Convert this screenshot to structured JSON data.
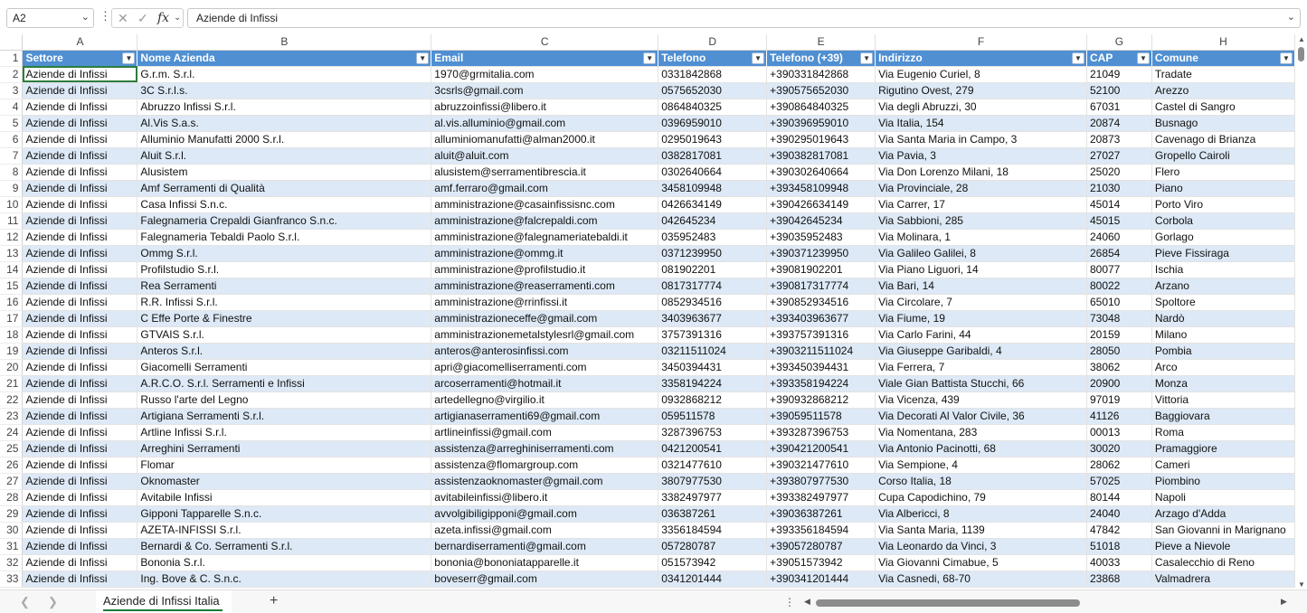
{
  "formula_bar": {
    "name_box": "A2",
    "cancel_icon": "✕",
    "enter_icon": "✓",
    "fx_label": "fx",
    "formula": "Aziende di Infissi"
  },
  "columns": [
    "A",
    "B",
    "C",
    "D",
    "E",
    "F",
    "G",
    "H"
  ],
  "headers": [
    "Settore",
    "Nome Azienda",
    "Email",
    "Telefono",
    "Telefono (+39)",
    "Indirizzo",
    "CAP",
    "Comune"
  ],
  "rows": [
    {
      "n": "2",
      "cells": [
        "Aziende di Infissi",
        "G.r.m. S.r.l.",
        "1970@grmitalia.com",
        "0331842868",
        "+390331842868",
        "Via Eugenio Curiel, 8",
        "21049",
        "Tradate"
      ]
    },
    {
      "n": "3",
      "cells": [
        "Aziende di Infissi",
        "3C S.r.l.s.",
        "3csrls@gmail.com",
        "0575652030",
        "+390575652030",
        "Rigutino Ovest, 279",
        "52100",
        "Arezzo"
      ]
    },
    {
      "n": "4",
      "cells": [
        "Aziende di Infissi",
        "Abruzzo Infissi S.r.l.",
        "abruzzoinfissi@libero.it",
        "0864840325",
        "+390864840325",
        "Via degli Abruzzi, 30",
        "67031",
        "Castel di Sangro"
      ]
    },
    {
      "n": "5",
      "cells": [
        "Aziende di Infissi",
        "Al.Vis S.a.s.",
        "al.vis.alluminio@gmail.com",
        "0396959010",
        "+390396959010",
        "Via Italia, 154",
        "20874",
        "Busnago"
      ]
    },
    {
      "n": "6",
      "cells": [
        "Aziende di Infissi",
        "Alluminio Manufatti 2000 S.r.l.",
        "alluminiomanufatti@alman2000.it",
        "0295019643",
        "+390295019643",
        "Via Santa Maria in Campo, 3",
        "20873",
        "Cavenago di Brianza"
      ]
    },
    {
      "n": "7",
      "cells": [
        "Aziende di Infissi",
        "Aluit S.r.l.",
        "aluit@aluit.com",
        "0382817081",
        "+390382817081",
        "Via Pavia, 3",
        "27027",
        "Gropello Cairoli"
      ]
    },
    {
      "n": "8",
      "cells": [
        "Aziende di Infissi",
        "Alusistem",
        "alusistem@serramentibrescia.it",
        "0302640664",
        "+390302640664",
        "Via Don Lorenzo Milani, 18",
        "25020",
        "Flero"
      ]
    },
    {
      "n": "9",
      "cells": [
        "Aziende di Infissi",
        "Amf Serramenti di Qualità",
        "amf.ferraro@gmail.com",
        "3458109948",
        "+393458109948",
        "Via Provinciale, 28",
        "21030",
        "Piano"
      ]
    },
    {
      "n": "10",
      "cells": [
        "Aziende di Infissi",
        "Casa Infissi S.n.c.",
        "amministrazione@casainfissisnc.com",
        "0426634149",
        "+390426634149",
        "Via Carrer, 17",
        "45014",
        "Porto Viro"
      ]
    },
    {
      "n": "11",
      "cells": [
        "Aziende di Infissi",
        "Falegnameria Crepaldi Gianfranco S.n.c.",
        "amministrazione@falcrepaldi.com",
        "042645234",
        "+39042645234",
        "Via Sabbioni, 285",
        "45015",
        "Corbola"
      ]
    },
    {
      "n": "12",
      "cells": [
        "Aziende di Infissi",
        "Falegnameria Tebaldi Paolo S.r.l.",
        "amministrazione@falegnameriatebaldi.it",
        "035952483",
        "+39035952483",
        "Via Molinara, 1",
        "24060",
        "Gorlago"
      ]
    },
    {
      "n": "13",
      "cells": [
        "Aziende di Infissi",
        "Ommg S.r.l.",
        "amministrazione@ommg.it",
        "0371239950",
        "+390371239950",
        "Via Galileo Galilei, 8",
        "26854",
        "Pieve Fissiraga"
      ]
    },
    {
      "n": "14",
      "cells": [
        "Aziende di Infissi",
        "Profilstudio S.r.l.",
        "amministrazione@profilstudio.it",
        "081902201",
        "+39081902201",
        "Via Piano Liguori, 14",
        "80077",
        "Ischia"
      ]
    },
    {
      "n": "15",
      "cells": [
        "Aziende di Infissi",
        "Rea Serramenti",
        "amministrazione@reaserramenti.com",
        "0817317774",
        "+390817317774",
        "Via Bari, 14",
        "80022",
        "Arzano"
      ]
    },
    {
      "n": "16",
      "cells": [
        "Aziende di Infissi",
        "R.R. Infissi S.r.l.",
        "amministrazione@rrinfissi.it",
        "0852934516",
        "+390852934516",
        "Via Circolare, 7",
        "65010",
        "Spoltore"
      ]
    },
    {
      "n": "17",
      "cells": [
        "Aziende di Infissi",
        "C Effe Porte & Finestre",
        "amministrazioneceffe@gmail.com",
        "3403963677",
        "+393403963677",
        "Via Fiume, 19",
        "73048",
        "Nardò"
      ]
    },
    {
      "n": "18",
      "cells": [
        "Aziende di Infissi",
        "GTVAIS S.r.l.",
        "amministrazionemetalstylesrl@gmail.com",
        "3757391316",
        "+393757391316",
        "Via Carlo Farini, 44",
        "20159",
        "Milano"
      ]
    },
    {
      "n": "19",
      "cells": [
        "Aziende di Infissi",
        "Anteros S.r.l.",
        "anteros@anterosinfissi.com",
        "03211511024",
        "+3903211511024",
        "Via Giuseppe Garibaldi, 4",
        "28050",
        "Pombia"
      ]
    },
    {
      "n": "20",
      "cells": [
        "Aziende di Infissi",
        "Giacomelli Serramenti",
        "apri@giacomelliserramenti.com",
        "3450394431",
        "+393450394431",
        "Via Ferrera, 7",
        "38062",
        "Arco"
      ]
    },
    {
      "n": "21",
      "cells": [
        "Aziende di Infissi",
        "A.R.C.O. S.r.l. Serramenti e Infissi",
        "arcoserramenti@hotmail.it",
        "3358194224",
        "+393358194224",
        "Viale Gian Battista Stucchi, 66",
        "20900",
        "Monza"
      ]
    },
    {
      "n": "22",
      "cells": [
        "Aziende di Infissi",
        "Russo l'arte del Legno",
        "artedellegno@virgilio.it",
        "0932868212",
        "+390932868212",
        "Via Vicenza, 439",
        "97019",
        "Vittoria"
      ]
    },
    {
      "n": "23",
      "cells": [
        "Aziende di Infissi",
        "Artigiana Serramenti S.r.l.",
        "artigianaserramenti69@gmail.com",
        "059511578",
        "+39059511578",
        "Via Decorati Al Valor Civile, 36",
        "41126",
        "Baggiovara"
      ]
    },
    {
      "n": "24",
      "cells": [
        "Aziende di Infissi",
        "Artline Infissi S.r.l.",
        "artlineinfissi@gmail.com",
        "3287396753",
        "+393287396753",
        "Via Nomentana, 283",
        "00013",
        "Roma"
      ]
    },
    {
      "n": "25",
      "cells": [
        "Aziende di Infissi",
        "Arreghini Serramenti",
        "assistenza@arreghiniserramenti.com",
        "0421200541",
        "+390421200541",
        "Via Antonio Pacinotti, 68",
        "30020",
        "Pramaggiore"
      ]
    },
    {
      "n": "26",
      "cells": [
        "Aziende di Infissi",
        "Flomar",
        "assistenza@flomargroup.com",
        "0321477610",
        "+390321477610",
        "Via Sempione, 4",
        "28062",
        "Cameri"
      ]
    },
    {
      "n": "27",
      "cells": [
        "Aziende di Infissi",
        "Oknomaster",
        "assistenzaoknomaster@gmail.com",
        "3807977530",
        "+393807977530",
        "Corso Italia, 18",
        "57025",
        "Piombino"
      ]
    },
    {
      "n": "28",
      "cells": [
        "Aziende di Infissi",
        "Avitabile Infissi",
        "avitabileinfissi@libero.it",
        "3382497977",
        "+393382497977",
        "Cupa Capodichino, 79",
        "80144",
        "Napoli"
      ]
    },
    {
      "n": "29",
      "cells": [
        "Aziende di Infissi",
        "Gipponi Tapparelle S.n.c.",
        "avvolgibiligipponi@gmail.com",
        "036387261",
        "+39036387261",
        "Via Albericci, 8",
        "24040",
        "Arzago d'Adda"
      ]
    },
    {
      "n": "30",
      "cells": [
        "Aziende di Infissi",
        "AZETA-INFISSI S.r.l.",
        "azeta.infissi@gmail.com",
        "3356184594",
        "+393356184594",
        "Via Santa Maria, 1139",
        "47842",
        "San Giovanni in Marignano"
      ]
    },
    {
      "n": "31",
      "cells": [
        "Aziende di Infissi",
        "Bernardi & Co. Serramenti S.r.l.",
        "bernardiserramenti@gmail.com",
        "057280787",
        "+39057280787",
        "Via Leonardo da Vinci, 3",
        "51018",
        "Pieve a Nievole"
      ]
    },
    {
      "n": "32",
      "cells": [
        "Aziende di Infissi",
        "Bononia S.r.l.",
        "bononia@bononiatapparelle.it",
        "051573942",
        "+39051573942",
        "Via Giovanni Cimabue, 5",
        "40033",
        "Casalecchio di Reno"
      ]
    },
    {
      "n": "33",
      "cells": [
        "Aziende di Infissi",
        "Ing. Bove & C. S.n.c.",
        "boveserr@gmail.com",
        "0341201444",
        "+390341201444",
        "Via Casnedi, 68-70",
        "23868",
        "Valmadrera"
      ]
    }
  ],
  "sheet_tab": "Aziende di Infissi Italia",
  "colors": {
    "header_fill": "#4f8fd2",
    "band_fill": "#dde9f6",
    "tab_accent": "#1e7a3a"
  }
}
